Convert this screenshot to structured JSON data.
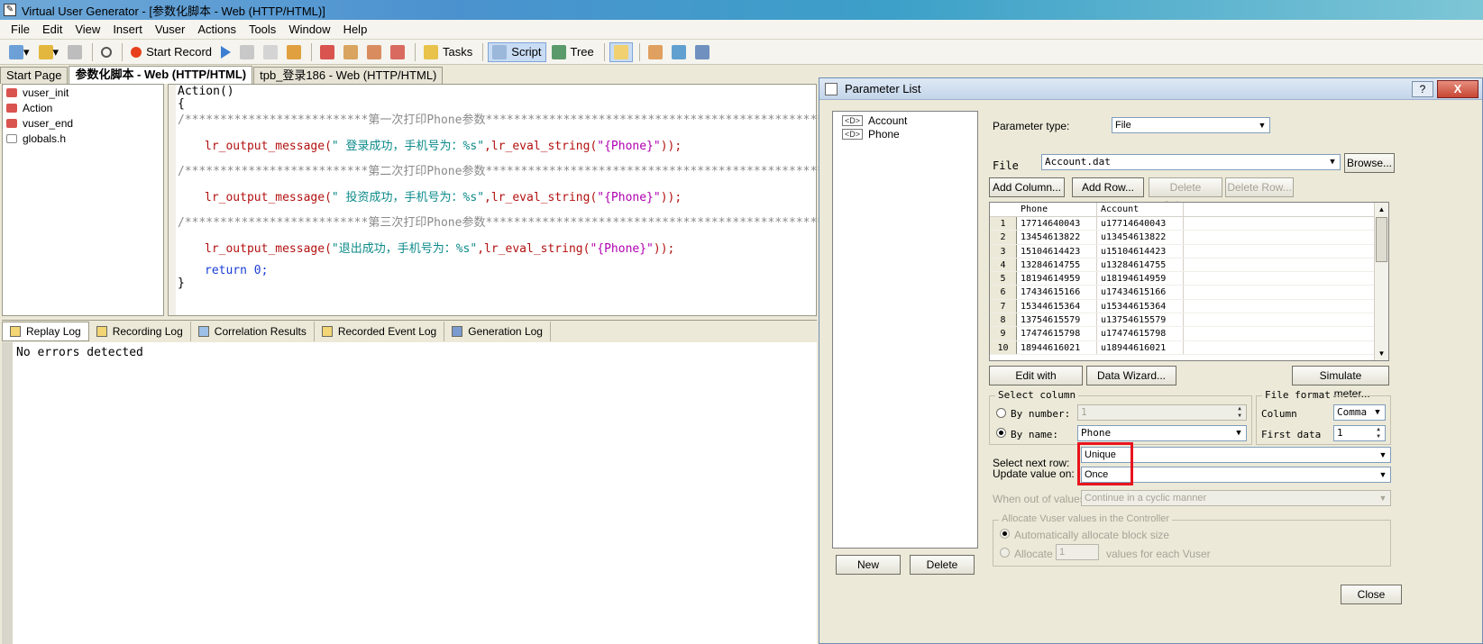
{
  "window": {
    "title": "Virtual User Generator - [参数化脚本 - Web (HTTP/HTML)]"
  },
  "menu": [
    "File",
    "Edit",
    "View",
    "Insert",
    "Vuser",
    "Actions",
    "Tools",
    "Window",
    "Help"
  ],
  "toolbar": {
    "start_record": "Start Record",
    "tasks": "Tasks",
    "script": "Script",
    "tree": "Tree"
  },
  "doc_tabs": [
    "Start Page",
    "参数化脚本 - Web (HTTP/HTML)",
    "tpb_登录186 - Web (HTTP/HTML)"
  ],
  "script_tree": [
    "vuser_init",
    "Action",
    "vuser_end",
    "globals.h"
  ],
  "code": {
    "l1": "Action()",
    "l2": "{",
    "c1": "/**************************第一次打印Phone参数**************************************************/",
    "fn": "lr_output_message",
    "s1": "\" 登录成功，手机号为：%s\"",
    "eval": "lr_eval_string",
    "p": "\"{Phone}\"",
    "c2": "/**************************第二次打印Phone参数**************************************************/",
    "s2": "\" 投资成功，手机号为：%s\"",
    "c3": "/**************************第三次打印Phone参数**************************************************/",
    "s3": "\"退出成功，手机号为：%s\"",
    "ret": "return",
    "zero": "0",
    "close_brace": "}"
  },
  "log_tabs": [
    "Replay Log",
    "Recording Log",
    "Correlation Results",
    "Recorded Event Log",
    "Generation Log"
  ],
  "log_text": "No errors detected",
  "dialog": {
    "title": "Parameter List",
    "help": "?",
    "close_x": "X",
    "params": [
      "Account",
      "Phone"
    ],
    "param_icon": "<D>",
    "param_type_label": "Parameter type:",
    "param_type": "File",
    "file_label": "File",
    "file_value": "Account.dat",
    "browse": "Browse...",
    "add_column": "Add Column...",
    "add_row": "Add Row...",
    "delete_column": "Delete Column...",
    "delete_row": "Delete Row...",
    "columns": [
      "Phone",
      "Account"
    ],
    "rows": [
      [
        "1",
        "17714640043",
        "u17714640043"
      ],
      [
        "2",
        "13454613822",
        "u13454613822"
      ],
      [
        "3",
        "15104614423",
        "u15104614423"
      ],
      [
        "4",
        "13284614755",
        "u13284614755"
      ],
      [
        "5",
        "18194614959",
        "u18194614959"
      ],
      [
        "6",
        "17434615166",
        "u17434615166"
      ],
      [
        "7",
        "15344615364",
        "u15344615364"
      ],
      [
        "8",
        "13754615579",
        "u13754615579"
      ],
      [
        "9",
        "17474615798",
        "u17474615798"
      ],
      [
        "10",
        "18944616021",
        "u18944616021"
      ]
    ],
    "edit_notepad": "Edit with Notepad...",
    "data_wizard": "Data Wizard...",
    "simulate": "Simulate Parameter...",
    "select_column_title": "Select column",
    "by_number": "By number:",
    "by_number_value": "1",
    "by_name": "By name:",
    "by_name_value": "Phone",
    "file_format_title": "File format",
    "column_label": "Column",
    "column_value": "Comma",
    "first_data_label": "First data",
    "first_data_value": "1",
    "select_next_row_label": "Select next row:",
    "select_next_row": "Unique",
    "update_value_label": "Update value on:",
    "update_value": "Once",
    "out_of_values_label": "When out of values:",
    "out_of_values": "Continue in a cyclic manner",
    "allocate_title": "Allocate Vuser values in the Controller",
    "auto_allocate": "Automatically allocate block size",
    "allocate": "Allocate",
    "allocate_value": "1",
    "allocate_suffix": "values for each Vuser",
    "new": "New",
    "delete": "Delete",
    "close": "Close"
  },
  "colors": {
    "highlight": "#e8141e",
    "accent": "#3c7ed1"
  }
}
